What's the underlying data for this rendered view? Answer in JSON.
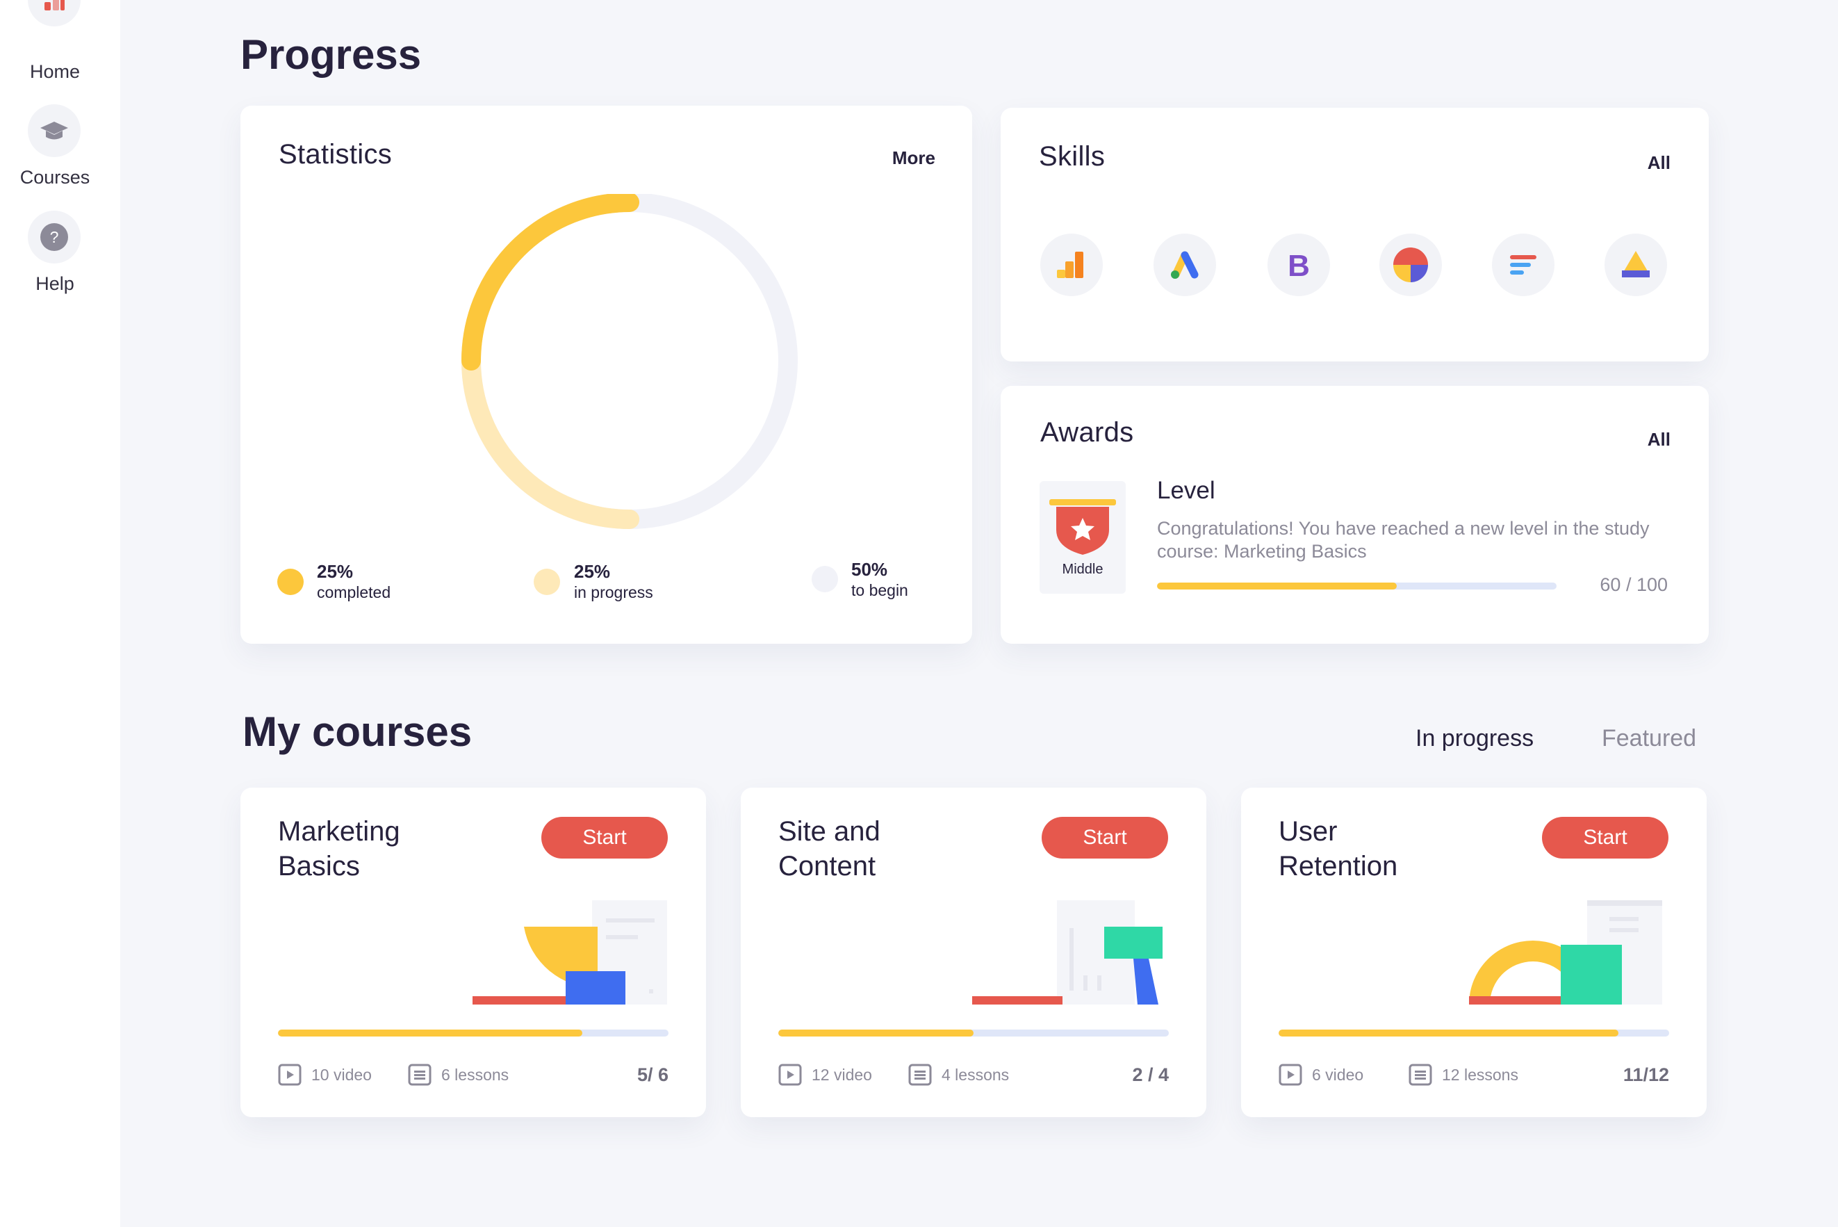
{
  "sidebar": {
    "items": [
      {
        "label": "Home",
        "icon": "bar-chart-icon"
      },
      {
        "label": "Courses",
        "icon": "graduation-cap-icon"
      },
      {
        "label": "Help",
        "icon": "question-icon"
      }
    ]
  },
  "page": {
    "title": "Progress",
    "courses_title": "My courses"
  },
  "statistics": {
    "title": "Statistics",
    "more_label": "More",
    "legend": [
      {
        "pct": "25%",
        "label": "completed",
        "value": 25,
        "color": "#fcc73c"
      },
      {
        "pct": "25%",
        "label": "in progress",
        "value": 25,
        "color": "#fee9b8"
      },
      {
        "pct": "50%",
        "label": "to begin",
        "value": 50,
        "color": "#f1f2f8"
      }
    ]
  },
  "skills": {
    "title": "Skills",
    "all_label": "All",
    "items": [
      {
        "icon": "google-analytics-icon"
      },
      {
        "icon": "google-ads-icon"
      },
      {
        "icon": "bootstrap-icon"
      },
      {
        "icon": "pie-chart-icon"
      },
      {
        "icon": "text-lines-icon"
      },
      {
        "icon": "triangle-logo-icon"
      }
    ]
  },
  "awards": {
    "title": "Awards",
    "all_label": "All",
    "badge_label": "Middle",
    "level_title": "Level",
    "description": "Congratulations! You have reached a new level in the study course: Marketing Basics",
    "progress": {
      "current": 60,
      "max": 100,
      "text": "60 / 100"
    }
  },
  "course_tabs": [
    {
      "label": "In progress",
      "active": true
    },
    {
      "label": "Featured",
      "active": false
    }
  ],
  "courses": [
    {
      "title": "Marketing Basics",
      "start_label": "Start",
      "video": "10 video",
      "lessons": "6 lessons",
      "count": "5/ 6",
      "progress": 0.78
    },
    {
      "title": "Site and Content",
      "start_label": "Start",
      "video": "12 video",
      "lessons": "4 lessons",
      "count": "2 / 4",
      "progress": 0.5
    },
    {
      "title": "User Retention",
      "start_label": "Start",
      "video": "6 video",
      "lessons": "12 lessons",
      "count": "11/12",
      "progress": 0.87
    }
  ],
  "colors": {
    "accent_yellow": "#fcc73c",
    "light_yellow": "#fee9b8",
    "accent_red": "#e6584d",
    "blue": "#3f6df0",
    "teal": "#2fd8a6",
    "track": "#dfe6f8",
    "background": "#f5f6fa"
  }
}
